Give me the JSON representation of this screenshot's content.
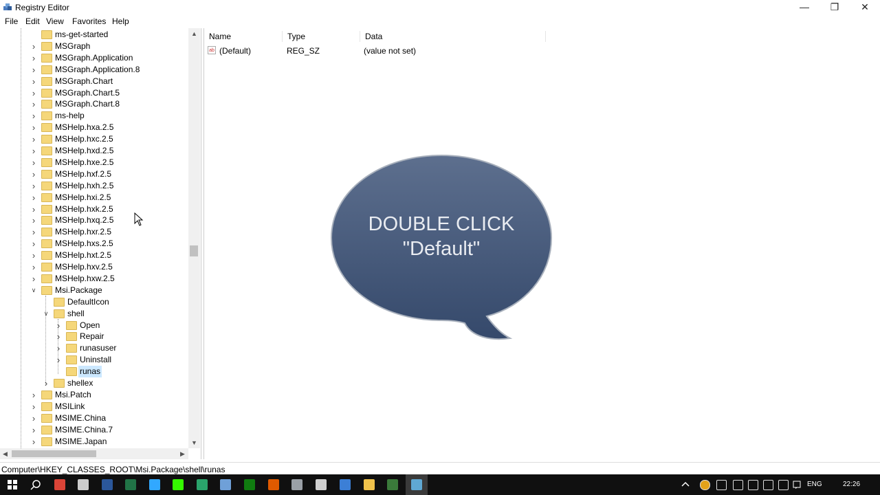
{
  "window": {
    "title": "Registry Editor"
  },
  "menu": [
    "File",
    "Edit",
    "View",
    "Favorites",
    "Help"
  ],
  "tree": {
    "items": [
      {
        "label": "ms-get-started",
        "level": 0,
        "expander": ""
      },
      {
        "label": "MSGraph",
        "level": 0,
        "expander": "›"
      },
      {
        "label": "MSGraph.Application",
        "level": 0,
        "expander": "›"
      },
      {
        "label": "MSGraph.Application.8",
        "level": 0,
        "expander": "›"
      },
      {
        "label": "MSGraph.Chart",
        "level": 0,
        "expander": "›"
      },
      {
        "label": "MSGraph.Chart.5",
        "level": 0,
        "expander": "›"
      },
      {
        "label": "MSGraph.Chart.8",
        "level": 0,
        "expander": "›"
      },
      {
        "label": "ms-help",
        "level": 0,
        "expander": "›"
      },
      {
        "label": "MSHelp.hxa.2.5",
        "level": 0,
        "expander": "›"
      },
      {
        "label": "MSHelp.hxc.2.5",
        "level": 0,
        "expander": "›"
      },
      {
        "label": "MSHelp.hxd.2.5",
        "level": 0,
        "expander": "›"
      },
      {
        "label": "MSHelp.hxe.2.5",
        "level": 0,
        "expander": "›"
      },
      {
        "label": "MSHelp.hxf.2.5",
        "level": 0,
        "expander": "›"
      },
      {
        "label": "MSHelp.hxh.2.5",
        "level": 0,
        "expander": "›"
      },
      {
        "label": "MSHelp.hxi.2.5",
        "level": 0,
        "expander": "›"
      },
      {
        "label": "MSHelp.hxk.2.5",
        "level": 0,
        "expander": "›"
      },
      {
        "label": "MSHelp.hxq.2.5",
        "level": 0,
        "expander": "›"
      },
      {
        "label": "MSHelp.hxr.2.5",
        "level": 0,
        "expander": "›"
      },
      {
        "label": "MSHelp.hxs.2.5",
        "level": 0,
        "expander": "›"
      },
      {
        "label": "MSHelp.hxt.2.5",
        "level": 0,
        "expander": "›"
      },
      {
        "label": "MSHelp.hxv.2.5",
        "level": 0,
        "expander": "›"
      },
      {
        "label": "MSHelp.hxw.2.5",
        "level": 0,
        "expander": "›"
      },
      {
        "label": "Msi.Package",
        "level": 0,
        "expander": "⌄"
      },
      {
        "label": "DefaultIcon",
        "level": 1,
        "expander": ""
      },
      {
        "label": "shell",
        "level": 1,
        "expander": "⌄"
      },
      {
        "label": "Open",
        "level": 2,
        "expander": "›"
      },
      {
        "label": "Repair",
        "level": 2,
        "expander": "›"
      },
      {
        "label": "runasuser",
        "level": 2,
        "expander": "›"
      },
      {
        "label": "Uninstall",
        "level": 2,
        "expander": "›"
      },
      {
        "label": "runas",
        "level": 2,
        "expander": "",
        "selected": true
      },
      {
        "label": "shellex",
        "level": 1,
        "expander": "›"
      },
      {
        "label": "Msi.Patch",
        "level": 0,
        "expander": "›"
      },
      {
        "label": "MSILink",
        "level": 0,
        "expander": "›"
      },
      {
        "label": "MSIME.China",
        "level": 0,
        "expander": "›"
      },
      {
        "label": "MSIME.China.7",
        "level": 0,
        "expander": "›"
      },
      {
        "label": "MSIME.Japan",
        "level": 0,
        "expander": "›"
      }
    ]
  },
  "list": {
    "columns": {
      "name": "Name",
      "type": "Type",
      "data": "Data"
    },
    "rows": [
      {
        "name": "(Default)",
        "type": "REG_SZ",
        "data": "(value not set)"
      }
    ]
  },
  "bubble": {
    "line1": "DOUBLE CLICK",
    "line2": "\"Default\""
  },
  "status": {
    "path": "Computer\\HKEY_CLASSES_ROOT\\Msi.Package\\shell\\runas"
  },
  "taskbar": {
    "language": "ENG",
    "time": "22:26",
    "apps": [
      "start-icon",
      "search-icon",
      "chrome-icon",
      "store-icon",
      "word-icon",
      "excel-icon",
      "photoshop-icon",
      "dreamweaver-icon",
      "maps-icon",
      "regedit-icon",
      "xbox-icon",
      "media-icon",
      "settings-icon",
      "calculator-icon",
      "network-icon",
      "explorer-icon",
      "terminal-icon",
      "registry-active-icon"
    ]
  }
}
